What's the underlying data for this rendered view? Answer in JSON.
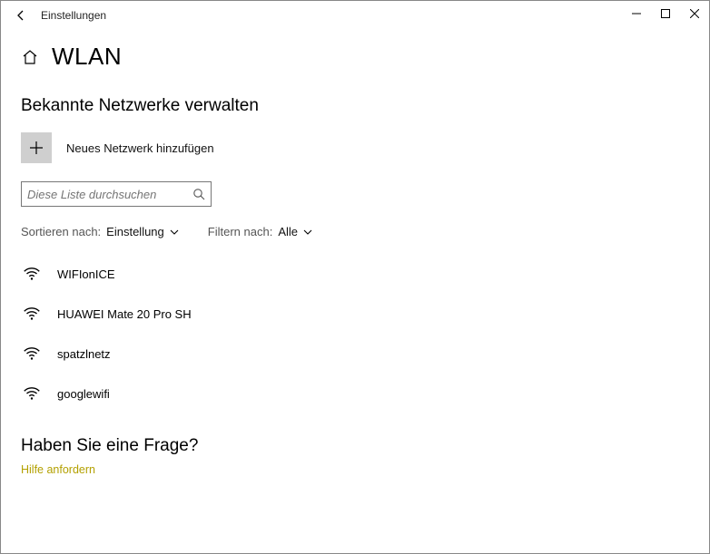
{
  "window": {
    "title": "Einstellungen"
  },
  "page": {
    "heading": "WLAN",
    "subheading": "Bekannte Netzwerke verwalten",
    "add_network_label": "Neues Netzwerk hinzufügen",
    "search_placeholder": "Diese Liste durchsuchen",
    "sort_label": "Sortieren nach:",
    "sort_value": "Einstellung",
    "filter_label": "Filtern nach:",
    "filter_value": "Alle",
    "question_heading": "Haben Sie eine Frage?",
    "help_link": "Hilfe anfordern"
  },
  "networks": [
    {
      "name": "WIFIonICE"
    },
    {
      "name": "HUAWEI Mate 20 Pro SH"
    },
    {
      "name": "spatzlnetz"
    },
    {
      "name": "googlewifi"
    }
  ]
}
